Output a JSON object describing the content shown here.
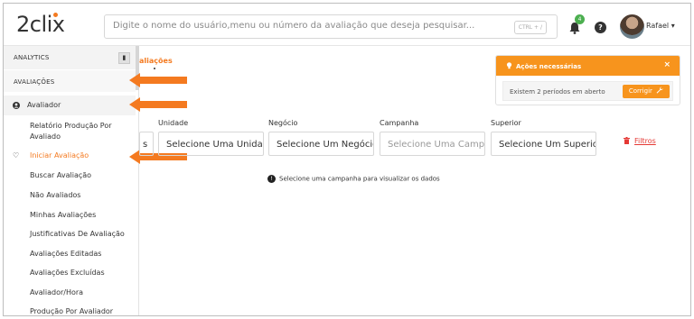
{
  "header": {
    "logo": "2clix",
    "search_placeholder": "Digite o nome do usuário,menu ou número da avaliação que deseja pesquisar...",
    "search_shortcut": "CTRL + /",
    "notification_count": "4",
    "help_label": "?",
    "user_name": "Rafael ▾"
  },
  "sidebar": {
    "section_analytics": "ANALYTICS",
    "section_avaliacoes": "AVALIAÇÕES",
    "group_avaliador": "Avaliador",
    "items": [
      {
        "label": "Relatório Produção Por"
      },
      {
        "label": "Avaliado"
      },
      {
        "label": "Iniciar Avaliação"
      },
      {
        "label": "Buscar Avaliação"
      },
      {
        "label": "Não Avaliados"
      },
      {
        "label": "Minhas Avaliações"
      },
      {
        "label": "Justificativas De Avaliação"
      },
      {
        "label": "Avaliações Editadas"
      },
      {
        "label": "Avaliações Excluídas"
      },
      {
        "label": "Avaliador/Hora"
      },
      {
        "label": "Produção Por Avaliador"
      }
    ]
  },
  "main": {
    "breadcrumb": "aliações",
    "filters": [
      {
        "label": "",
        "value": "s"
      },
      {
        "label": "Unidade",
        "value": "Selecione Uma Unidade"
      },
      {
        "label": "Negócio",
        "value": "Selecione Um Negócio"
      },
      {
        "label": "Campanha",
        "value": "Selecione Uma Campanha"
      },
      {
        "label": "Superior",
        "value": "Selecione Um Superior"
      }
    ],
    "filtros_label": "Filtros",
    "info_text": "Selecione uma campanha para visualizar os dados"
  },
  "alert": {
    "title": "Ações necessárias",
    "close": "×",
    "message": "Existem 2 períodos em aberto",
    "button": "Corrigir"
  },
  "colors": {
    "accent": "#f7941d",
    "arrow": "#f47a20",
    "danger": "#e53935"
  }
}
